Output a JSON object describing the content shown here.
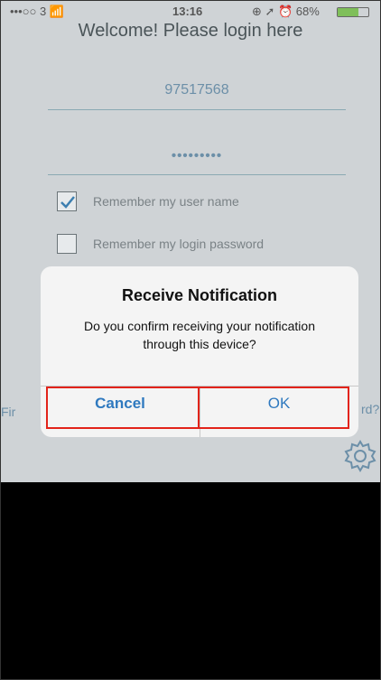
{
  "status_bar": {
    "carrier": "•••○○ 3",
    "time": "13:16",
    "battery": "68%",
    "battery_level": 0.68,
    "right_icons": "⊕ ➚ ⏰ 68%"
  },
  "login": {
    "welcome": "Welcome! Please login here",
    "username_value": "97517568",
    "password_value": "•••••••••",
    "remember_user_label": "Remember my user name",
    "remember_user_checked": true,
    "remember_password_label": "Remember my login password",
    "remember_password_checked": false,
    "side_left_fragment": "Fir",
    "side_right_fragment": "rd?"
  },
  "dialog": {
    "title": "Receive Notification",
    "message": "Do you confirm receiving your notification through this device?",
    "cancel_label": "Cancel",
    "ok_label": "OK"
  },
  "colors": {
    "accent": "#2f79bf",
    "highlight": "#e2231a",
    "dimmed_bg": "#cfd3d6"
  },
  "icons": {
    "settings": "gear-icon",
    "checkbox_checked": "checkmark-icon",
    "wifi": "wifi-icon"
  }
}
